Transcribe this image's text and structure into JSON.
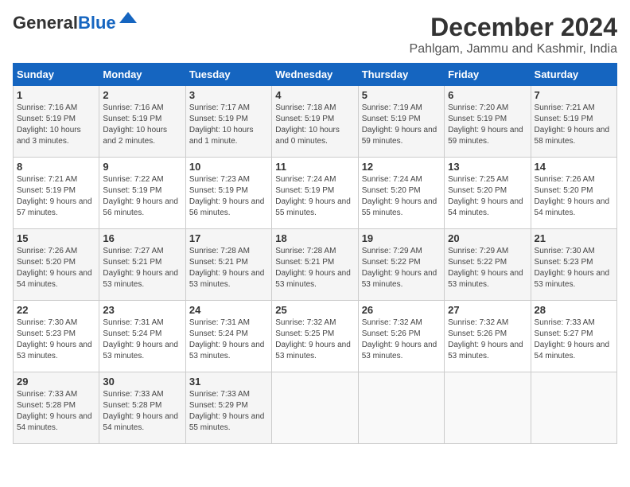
{
  "header": {
    "logo_general": "General",
    "logo_blue": "Blue",
    "month": "December 2024",
    "location": "Pahlgam, Jammu and Kashmir, India"
  },
  "columns": [
    "Sunday",
    "Monday",
    "Tuesday",
    "Wednesday",
    "Thursday",
    "Friday",
    "Saturday"
  ],
  "weeks": [
    [
      {
        "day": "1",
        "sunrise": "Sunrise: 7:16 AM",
        "sunset": "Sunset: 5:19 PM",
        "daylight": "Daylight: 10 hours and 3 minutes."
      },
      {
        "day": "2",
        "sunrise": "Sunrise: 7:16 AM",
        "sunset": "Sunset: 5:19 PM",
        "daylight": "Daylight: 10 hours and 2 minutes."
      },
      {
        "day": "3",
        "sunrise": "Sunrise: 7:17 AM",
        "sunset": "Sunset: 5:19 PM",
        "daylight": "Daylight: 10 hours and 1 minute."
      },
      {
        "day": "4",
        "sunrise": "Sunrise: 7:18 AM",
        "sunset": "Sunset: 5:19 PM",
        "daylight": "Daylight: 10 hours and 0 minutes."
      },
      {
        "day": "5",
        "sunrise": "Sunrise: 7:19 AM",
        "sunset": "Sunset: 5:19 PM",
        "daylight": "Daylight: 9 hours and 59 minutes."
      },
      {
        "day": "6",
        "sunrise": "Sunrise: 7:20 AM",
        "sunset": "Sunset: 5:19 PM",
        "daylight": "Daylight: 9 hours and 59 minutes."
      },
      {
        "day": "7",
        "sunrise": "Sunrise: 7:21 AM",
        "sunset": "Sunset: 5:19 PM",
        "daylight": "Daylight: 9 hours and 58 minutes."
      }
    ],
    [
      {
        "day": "8",
        "sunrise": "Sunrise: 7:21 AM",
        "sunset": "Sunset: 5:19 PM",
        "daylight": "Daylight: 9 hours and 57 minutes."
      },
      {
        "day": "9",
        "sunrise": "Sunrise: 7:22 AM",
        "sunset": "Sunset: 5:19 PM",
        "daylight": "Daylight: 9 hours and 56 minutes."
      },
      {
        "day": "10",
        "sunrise": "Sunrise: 7:23 AM",
        "sunset": "Sunset: 5:19 PM",
        "daylight": "Daylight: 9 hours and 56 minutes."
      },
      {
        "day": "11",
        "sunrise": "Sunrise: 7:24 AM",
        "sunset": "Sunset: 5:19 PM",
        "daylight": "Daylight: 9 hours and 55 minutes."
      },
      {
        "day": "12",
        "sunrise": "Sunrise: 7:24 AM",
        "sunset": "Sunset: 5:20 PM",
        "daylight": "Daylight: 9 hours and 55 minutes."
      },
      {
        "day": "13",
        "sunrise": "Sunrise: 7:25 AM",
        "sunset": "Sunset: 5:20 PM",
        "daylight": "Daylight: 9 hours and 54 minutes."
      },
      {
        "day": "14",
        "sunrise": "Sunrise: 7:26 AM",
        "sunset": "Sunset: 5:20 PM",
        "daylight": "Daylight: 9 hours and 54 minutes."
      }
    ],
    [
      {
        "day": "15",
        "sunrise": "Sunrise: 7:26 AM",
        "sunset": "Sunset: 5:20 PM",
        "daylight": "Daylight: 9 hours and 54 minutes."
      },
      {
        "day": "16",
        "sunrise": "Sunrise: 7:27 AM",
        "sunset": "Sunset: 5:21 PM",
        "daylight": "Daylight: 9 hours and 53 minutes."
      },
      {
        "day": "17",
        "sunrise": "Sunrise: 7:28 AM",
        "sunset": "Sunset: 5:21 PM",
        "daylight": "Daylight: 9 hours and 53 minutes."
      },
      {
        "day": "18",
        "sunrise": "Sunrise: 7:28 AM",
        "sunset": "Sunset: 5:21 PM",
        "daylight": "Daylight: 9 hours and 53 minutes."
      },
      {
        "day": "19",
        "sunrise": "Sunrise: 7:29 AM",
        "sunset": "Sunset: 5:22 PM",
        "daylight": "Daylight: 9 hours and 53 minutes."
      },
      {
        "day": "20",
        "sunrise": "Sunrise: 7:29 AM",
        "sunset": "Sunset: 5:22 PM",
        "daylight": "Daylight: 9 hours and 53 minutes."
      },
      {
        "day": "21",
        "sunrise": "Sunrise: 7:30 AM",
        "sunset": "Sunset: 5:23 PM",
        "daylight": "Daylight: 9 hours and 53 minutes."
      }
    ],
    [
      {
        "day": "22",
        "sunrise": "Sunrise: 7:30 AM",
        "sunset": "Sunset: 5:23 PM",
        "daylight": "Daylight: 9 hours and 53 minutes."
      },
      {
        "day": "23",
        "sunrise": "Sunrise: 7:31 AM",
        "sunset": "Sunset: 5:24 PM",
        "daylight": "Daylight: 9 hours and 53 minutes."
      },
      {
        "day": "24",
        "sunrise": "Sunrise: 7:31 AM",
        "sunset": "Sunset: 5:24 PM",
        "daylight": "Daylight: 9 hours and 53 minutes."
      },
      {
        "day": "25",
        "sunrise": "Sunrise: 7:32 AM",
        "sunset": "Sunset: 5:25 PM",
        "daylight": "Daylight: 9 hours and 53 minutes."
      },
      {
        "day": "26",
        "sunrise": "Sunrise: 7:32 AM",
        "sunset": "Sunset: 5:26 PM",
        "daylight": "Daylight: 9 hours and 53 minutes."
      },
      {
        "day": "27",
        "sunrise": "Sunrise: 7:32 AM",
        "sunset": "Sunset: 5:26 PM",
        "daylight": "Daylight: 9 hours and 53 minutes."
      },
      {
        "day": "28",
        "sunrise": "Sunrise: 7:33 AM",
        "sunset": "Sunset: 5:27 PM",
        "daylight": "Daylight: 9 hours and 54 minutes."
      }
    ],
    [
      {
        "day": "29",
        "sunrise": "Sunrise: 7:33 AM",
        "sunset": "Sunset: 5:28 PM",
        "daylight": "Daylight: 9 hours and 54 minutes."
      },
      {
        "day": "30",
        "sunrise": "Sunrise: 7:33 AM",
        "sunset": "Sunset: 5:28 PM",
        "daylight": "Daylight: 9 hours and 54 minutes."
      },
      {
        "day": "31",
        "sunrise": "Sunrise: 7:33 AM",
        "sunset": "Sunset: 5:29 PM",
        "daylight": "Daylight: 9 hours and 55 minutes."
      },
      null,
      null,
      null,
      null
    ]
  ]
}
